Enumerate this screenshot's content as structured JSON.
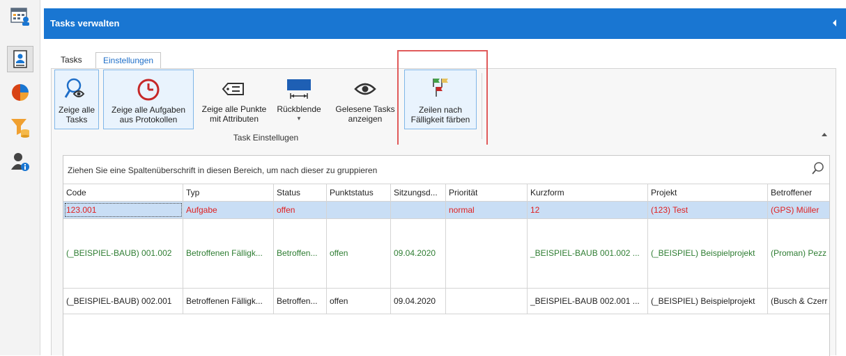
{
  "header": {
    "title": "Tasks verwalten"
  },
  "tabs": [
    {
      "label": "Tasks"
    },
    {
      "label": "Einstellungen"
    }
  ],
  "ribbon": {
    "buttons": [
      {
        "label_line1": "Zeige alle",
        "label_line2": "Tasks",
        "icon": "search-eye-icon"
      },
      {
        "label_line1": "Zeige alle Aufgaben",
        "label_line2": "aus Protokollen",
        "icon": "clock-icon"
      },
      {
        "label_line1": "Zeige alle Punkte",
        "label_line2": "mit Attributen",
        "icon": "tag-icon"
      },
      {
        "label_line1": "Rückblende",
        "label_line2": "",
        "icon": "range-icon"
      },
      {
        "label_line1": "Gelesene Tasks",
        "label_line2": "anzeigen",
        "icon": "eye-icon"
      },
      {
        "label_line1": "Zeilen nach",
        "label_line2": "Fälligkeit färben",
        "icon": "flags-icon"
      }
    ],
    "group_label": "Task Einstellugen"
  },
  "grid": {
    "group_hint": "Ziehen Sie eine Spaltenüberschrift in diesen Bereich, um nach dieser zu gruppieren",
    "columns": [
      "Code",
      "Typ",
      "Status",
      "Punktstatus",
      "Sitzungsd...",
      "Priorität",
      "Kurzform",
      "Projekt",
      "Betroffener"
    ],
    "rows": [
      [
        "123.001",
        "Aufgabe",
        "offen",
        "",
        "",
        "normal",
        "12",
        "(123) Test",
        "(GPS) Müller"
      ],
      [
        "(_BEISPIEL-BAUB) 001.002",
        "Betroffenen Fälligk...",
        "Betroffen...",
        "offen",
        "09.04.2020",
        "",
        "_BEISPIEL-BAUB 001.002 ...",
        "(_BEISPIEL) Beispielprojekt",
        "(Proman) Pezz"
      ],
      [
        "(_BEISPIEL-BAUB) 002.001",
        "Betroffenen Fälligk...",
        "Betroffen...",
        "offen",
        "09.04.2020",
        "",
        "_BEISPIEL-BAUB 002.001 ...",
        "(_BEISPIEL) Beispielprojekt",
        "(Busch & Czerr"
      ]
    ]
  },
  "colors": {
    "accent": "#1976d2",
    "overdue": "#e02020",
    "due_later": "#2e7d32",
    "highlight": "#e05a5a"
  },
  "leftbar": {
    "icons": [
      "calendar-person-icon",
      "person-card-icon",
      "pie-chart-icon",
      "filter-db-icon",
      "person-info-icon"
    ]
  }
}
